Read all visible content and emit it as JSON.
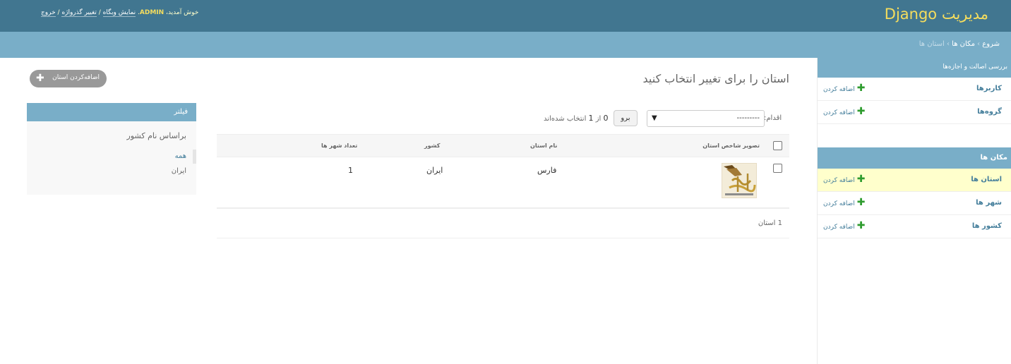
{
  "header": {
    "brand": "مدیریت Django",
    "welcome": "خوش آمدید، ",
    "username": "ADMIN",
    "view_site": "نمایش وبگاه",
    "change_password": "تغییر گذرواژه",
    "logout": "خروج",
    "sep": " / "
  },
  "breadcrumbs": {
    "home": "شروع",
    "app": "مکان ها",
    "current": "استان ها",
    "sep": " › "
  },
  "sidebar": {
    "auth": {
      "caption": "بررسی اصالت و اجازه‌ها",
      "items": [
        {
          "name": "کاربرها",
          "add": "اضافه کردن"
        },
        {
          "name": "گروه‌ها",
          "add": "اضافه کردن"
        }
      ]
    },
    "places": {
      "caption": "مکان ها",
      "items": [
        {
          "name": "استان ها",
          "add": "اضافه کردن"
        },
        {
          "name": "شهر ها",
          "add": "اضافه کردن"
        },
        {
          "name": "کشور ها",
          "add": "اضافه کردن"
        }
      ]
    }
  },
  "main": {
    "title": "استان را برای تغییر انتخاب کنید",
    "add_button": "اضافه‌کردن استان",
    "actions_label": "اقدام:",
    "actions_select_value": "---------",
    "go_button": "برو",
    "selected_count_prefix": "0",
    "selected_count_mid": " از ",
    "selected_count_total": "1",
    "selected_count_suffix": " انتخاب شده‌اند",
    "columns": [
      "تصویر شاخص استان",
      "نام استان",
      "کشور",
      "تعداد شهر ها"
    ],
    "rows": [
      {
        "image_alt": "شاخص",
        "name": "فارس",
        "country": "ایران",
        "city_count": "1"
      }
    ],
    "paginator": "1 استان"
  },
  "filter": {
    "title": "فیلتر",
    "by": "براساس نام کشور",
    "options": [
      "همه",
      "ایران"
    ],
    "selected": "همه"
  },
  "colors": {
    "header_bg": "#417690",
    "breadcrumb_bg": "#79aec8",
    "brand": "#f5dd5d",
    "link": "#447e9b",
    "add_icon": "#2f9c2f",
    "active_row": "#ffffcc"
  }
}
